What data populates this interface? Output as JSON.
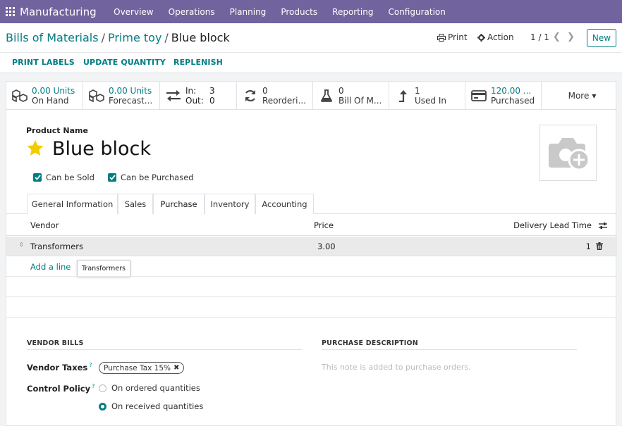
{
  "nav": {
    "app_name": "Manufacturing",
    "menus": [
      "Overview",
      "Operations",
      "Planning",
      "Products",
      "Reporting",
      "Configuration"
    ]
  },
  "breadcrumbs": [
    "Bills of Materials",
    "Prime toy",
    "Blue block"
  ],
  "control": {
    "print_label": "Print",
    "action_label": "Action",
    "pager": "1 / 1",
    "new_label": "New"
  },
  "actions": [
    "PRINT LABELS",
    "UPDATE QUANTITY",
    "REPLENISH"
  ],
  "stats": {
    "on_hand": {
      "value": "0.00 Units",
      "label": "On Hand"
    },
    "forecast": {
      "value": "0.00 Units",
      "label": "Forecast..."
    },
    "in_label": "In:",
    "in_value": "3",
    "out_label": "Out:",
    "out_value": "0",
    "reordering": {
      "value": "0",
      "label": "Reorderi..."
    },
    "bom": {
      "value": "0",
      "label": "Bill Of M..."
    },
    "used_in": {
      "value": "1",
      "label": "Used In"
    },
    "purchased": {
      "value": "120.00 ...",
      "label": "Purchased"
    },
    "more_label": "More"
  },
  "product": {
    "name_label": "Product Name",
    "name": "Blue block",
    "can_be_sold": "Can be Sold",
    "can_be_purchased": "Can be Purchased"
  },
  "tabs": [
    "General Information",
    "Sales",
    "Purchase",
    "Inventory",
    "Accounting"
  ],
  "vendor_table": {
    "headers": {
      "vendor": "Vendor",
      "price": "Price",
      "lead_time": "Delivery Lead Time"
    },
    "rows": [
      {
        "vendor": "Transformers",
        "price": "3.00",
        "lead_time": "1"
      }
    ],
    "add_line": "Add a line",
    "tooltip": "Transformers"
  },
  "vendor_bills": {
    "title": "VENDOR BILLS",
    "taxes_label": "Vendor Taxes",
    "tax_tag": "Purchase Tax 15%",
    "control_policy_label": "Control Policy",
    "help_mark": "?",
    "options": [
      "On ordered quantities",
      "On received quantities"
    ],
    "selected_index": 1
  },
  "purchase_description": {
    "title": "PURCHASE DESCRIPTION",
    "placeholder": "This note is added to purchase orders."
  },
  "colors": {
    "brand": "#71639e",
    "accent": "#017e84"
  }
}
